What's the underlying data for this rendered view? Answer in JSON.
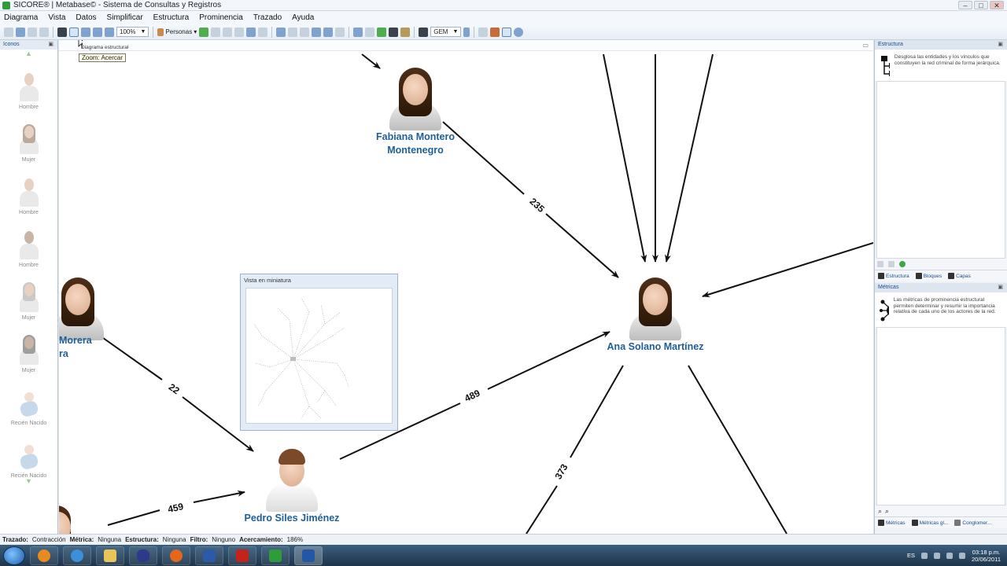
{
  "window": {
    "title": "SICORE® | Metabase© - Sistema de Consultas y Registros",
    "controls": [
      "–",
      "□",
      "✕"
    ]
  },
  "menu": [
    "Diagrama",
    "Vista",
    "Datos",
    "Simplificar",
    "Estructura",
    "Prominencia",
    "Trazado",
    "Ayuda"
  ],
  "toolbar": {
    "zoom_value": "100%",
    "personas_label": "Personas",
    "layout_value": "GEM"
  },
  "left_panel": {
    "title": "Iconos",
    "items": [
      "Hombre",
      "Mujer",
      "Hombre",
      "Hombre",
      "Mujer",
      "Mujer",
      "Recién Nacido",
      "Recién Nacido"
    ]
  },
  "canvas": {
    "tab_label": "Diagrama estructural",
    "tooltip": "Zoom: Acercar",
    "nodes": {
      "fabiana": [
        "Fabiana Montero",
        "Montenegro"
      ],
      "ana": "Ana Solano Martínez",
      "pedro": "Pedro Siles Jiménez",
      "partial": [
        "Morera",
        "ra"
      ]
    },
    "edge_labels": [
      "235",
      "22",
      "489",
      "373",
      "459"
    ],
    "miniature_title": "Vista en miniatura"
  },
  "right_panel": {
    "estructura": {
      "title": "Estructura",
      "description": "Desglosa las entidades y los vínculos que constituyen la red criminal de forma jerárquica."
    },
    "tabs": [
      "Estructura",
      "Bloques",
      "Capas"
    ],
    "metricas": {
      "title": "Métricas",
      "description": "Las métricas de prominencia estructural permiten determinar y resumir la importancia relativa de cada uno de los actores de la red."
    },
    "bottom_tabs": [
      "Métricas",
      "Métricas gl...",
      "Conglomer..."
    ]
  },
  "status": {
    "trazado_label": "Trazado:",
    "trazado_value": "Contracción",
    "metrica_label": "Métrica:",
    "metrica_value": "Ninguna",
    "estructura_label": "Estructura:",
    "estructura_value": "Ninguna",
    "filtro_label": "Filtro:",
    "filtro_value": "Ninguno",
    "acercamiento_label": "Acercamiento:",
    "acercamiento_value": "186%"
  },
  "taskbar": {
    "lang": "ES",
    "time": "03:18 p.m.",
    "date": "20/06/2011"
  },
  "colors": {
    "node_name": "#1f5f98",
    "panel_title": "#1b4d8e"
  }
}
